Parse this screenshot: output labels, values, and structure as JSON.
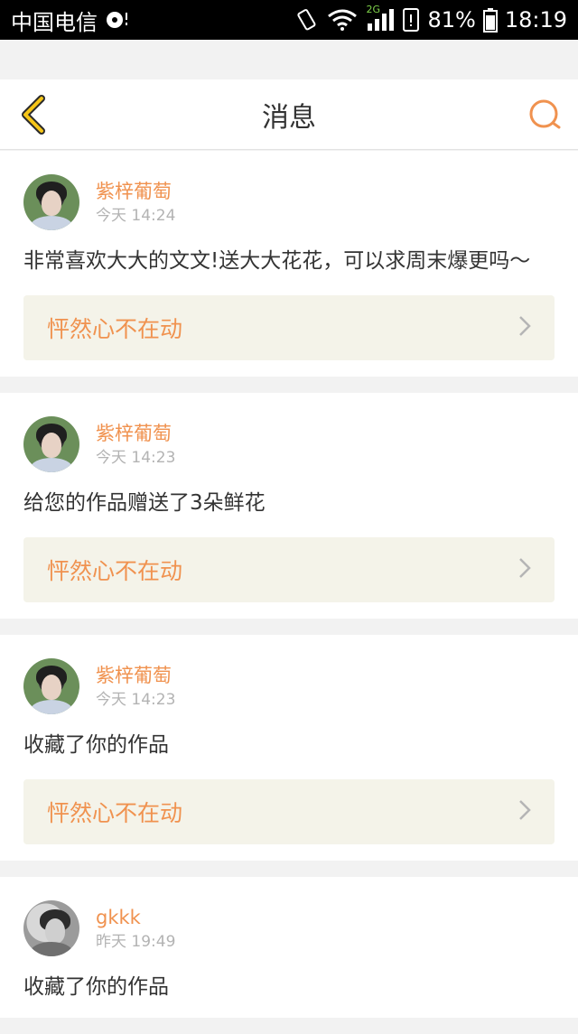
{
  "status_bar": {
    "carrier": "中国电信",
    "battery": "81%",
    "network": "2G",
    "time": "18:19"
  },
  "header": {
    "title": "消息"
  },
  "messages": [
    {
      "username": "紫梓葡萄",
      "time": "今天 14:24",
      "content": "非常喜欢大大的文文!送大大花花，可以求周末爆更吗～",
      "work_title": "怦然心不在动"
    },
    {
      "username": "紫梓葡萄",
      "time": "今天 14:23",
      "content": "给您的作品赠送了3朵鲜花",
      "work_title": "怦然心不在动"
    },
    {
      "username": "紫梓葡萄",
      "time": "今天 14:23",
      "content": "收藏了你的作品",
      "work_title": "怦然心不在动"
    },
    {
      "username": "gkkk",
      "time": "昨天 19:49",
      "content": "收藏了你的作品"
    }
  ],
  "colors": {
    "accent": "#f0924f",
    "back_arrow": "#f5c518",
    "link_bg": "#f4f3e9"
  }
}
